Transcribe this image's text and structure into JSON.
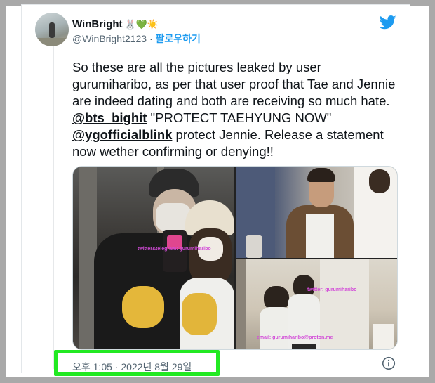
{
  "colors": {
    "frame": "#a9a9a9",
    "twitter_blue": "#1d9bf0",
    "highlight": "#22e922",
    "watermark": "#d24bd8"
  },
  "author": {
    "display_name": "WinBright",
    "emoji": "🐰💚☀️",
    "handle": "@WinBright2123",
    "separator": "·",
    "follow_label": "팔로우하기"
  },
  "tweet": {
    "text_before_1": "So these are all the pictures leaked by user gurumiharibo, as per that user proof that Tae and Jennie are indeed dating and both are receiving so much hate. ",
    "mention_1": "@bts_bighit",
    "text_between": " \"PROTECT TAEHYUNG NOW\" ",
    "mention_2": "@ygofficialblink",
    "text_after": " protect Jennie. Release a statement now wether confirming or denying!!",
    "timestamp": "오후 1:05 · 2022년 8월 29일"
  },
  "media": {
    "watermark_1": "twitter&telegram: gurumiharibo",
    "watermark_2": "twitter: gurumiharibo",
    "watermark_3": "email: gurumiharibo@proton.me"
  },
  "icons": {
    "logo": "twitter-bird-icon",
    "info": "info-icon"
  }
}
